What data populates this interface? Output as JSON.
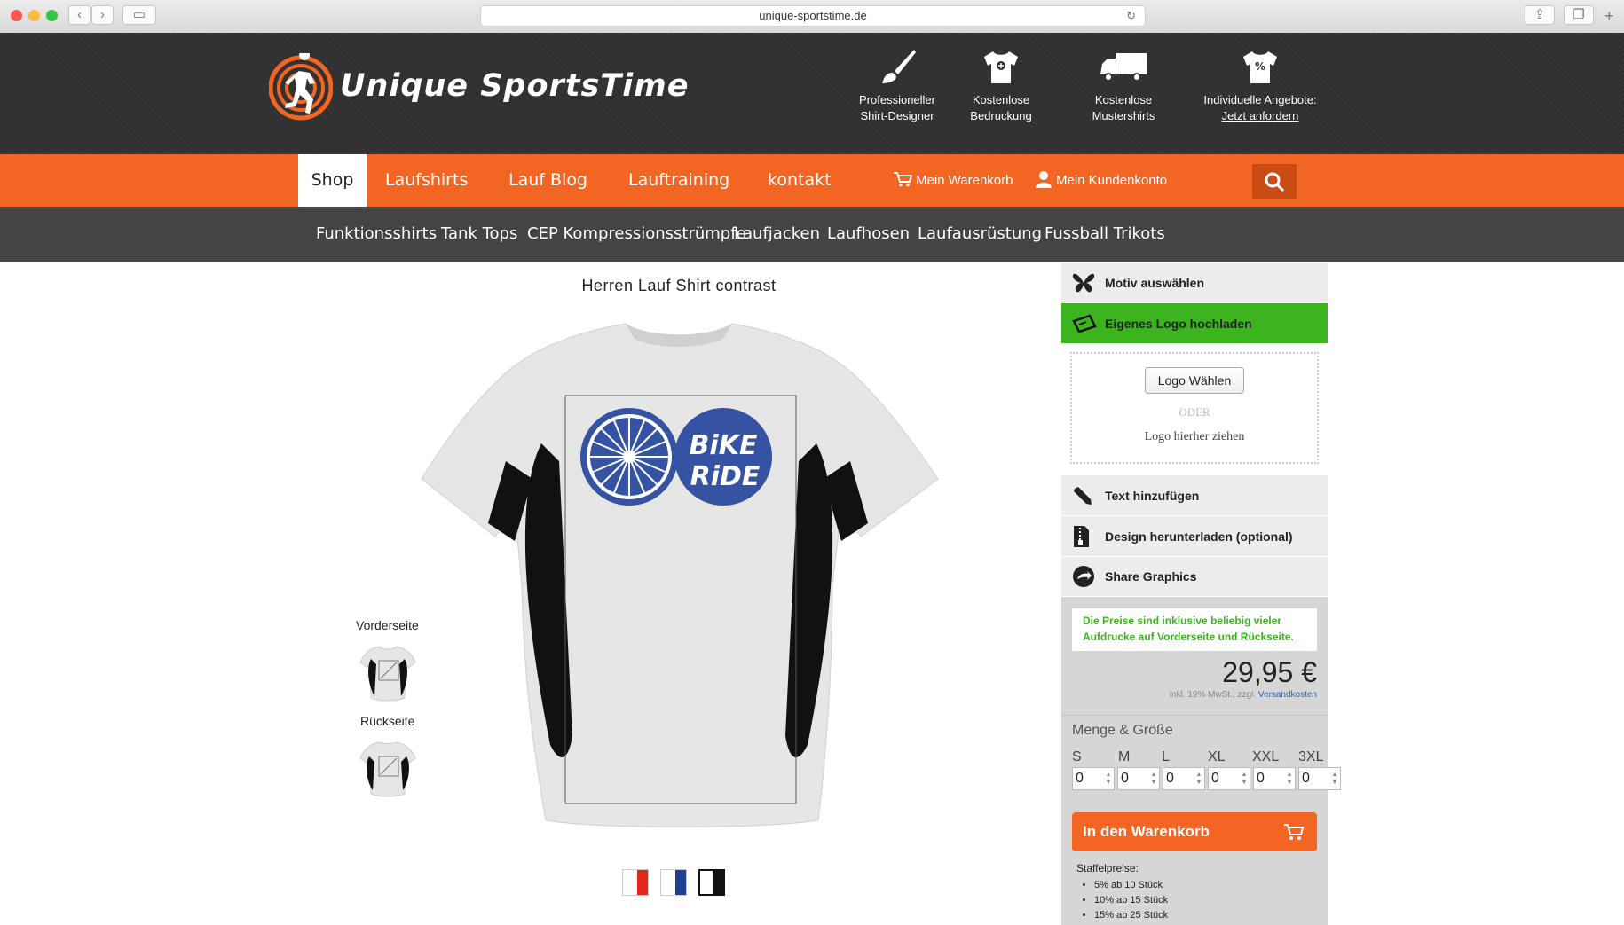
{
  "browser": {
    "url": "unique-sportstime.de"
  },
  "header": {
    "logo_text": "Unique SportsTime",
    "features": [
      {
        "line1": "Professioneller",
        "line2": "Shirt-Designer",
        "icon": "brush-icon"
      },
      {
        "line1": "Kostenlose",
        "line2": "Bedruckung",
        "icon": "tshirt-plus-icon"
      },
      {
        "line1": "Kostenlose",
        "line2": "Mustershirts",
        "icon": "truck-icon"
      },
      {
        "line1": "Individuelle Angebote:",
        "line2": "Jetzt anfordern",
        "icon": "tshirt-percent-icon"
      }
    ]
  },
  "nav": {
    "items": [
      "Shop",
      "Laufshirts",
      "Lauf Blog",
      "Lauftraining",
      "kontakt"
    ],
    "cart": "Mein Warenkorb",
    "account": "Mein Kundenkonto"
  },
  "subnav": [
    "Funktionsshirts",
    "Tank Tops",
    "CEP Kompressionsstrümpfe",
    "Laufjacken",
    "Laufhosen",
    "Laufausrüstung",
    "Fussball Trikots"
  ],
  "product": {
    "title": "Herren Lauf Shirt contrast",
    "design_text": [
      "BiKE",
      "RiDE"
    ],
    "sides": [
      "Vorderseite",
      "Rückseite"
    ],
    "swatch_colors": [
      "#e3261b",
      "#1d3f96",
      "#111111"
    ]
  },
  "designer": {
    "motiv": "Motiv auswählen",
    "logo_upload": "Eigenes Logo hochladen",
    "logo_button": "Logo Wählen",
    "oder": "ODER",
    "drop_hint": "Logo hierher ziehen",
    "text_add": "Text hinzufügen",
    "download": "Design herunterladen (optional)",
    "share": "Share Graphics"
  },
  "pricing": {
    "note": "Die Preise sind inklusive beliebig vieler Aufdrucke auf Vorderseite und Rückseite.",
    "price": "29,95 €",
    "tax_note": "inkl. 19% MwSt., zzgl.",
    "shipping_link": "Versandkosten",
    "qty_label": "Menge & Größe",
    "sizes": [
      "S",
      "M",
      "L",
      "XL",
      "XXL",
      "3XL"
    ],
    "quantities": [
      "0",
      "0",
      "0",
      "0",
      "0",
      "0"
    ],
    "cart_button": "In den Warenkorb",
    "staffel_title": "Staffelpreise:",
    "staffel": [
      "5% ab 10 Stück",
      "10% ab 15 Stück",
      "15% ab 25 Stück"
    ]
  },
  "colors": {
    "accent": "#f26522",
    "green": "#3cb41e",
    "design_blue": "#3552a3"
  }
}
